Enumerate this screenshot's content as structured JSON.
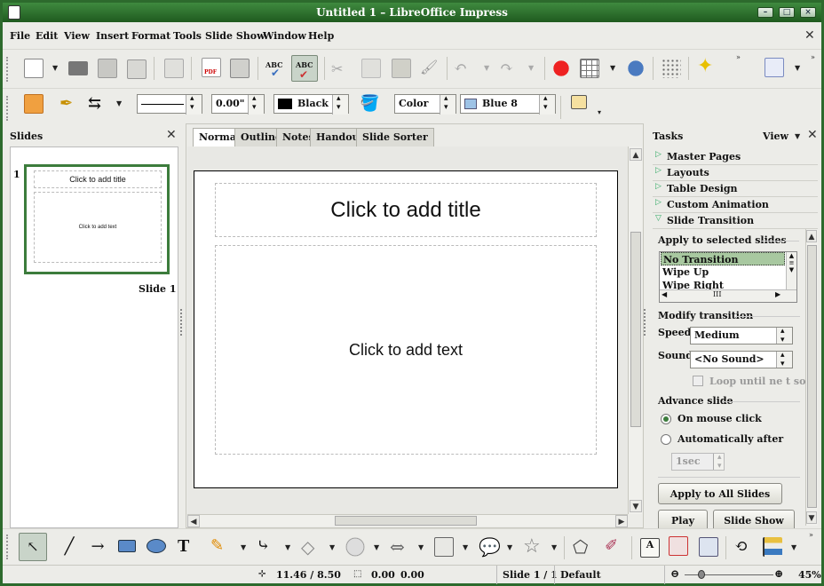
{
  "window": {
    "title": "Untitled  1  –  LibreOffice  Impress"
  },
  "menu": [
    "File",
    "Edit",
    "View",
    "Insert",
    "Format",
    "Tools",
    "Slide Show",
    "Window",
    "Help"
  ],
  "toolbar2": {
    "line_width": "0.00\"",
    "line_color": "Black",
    "area_style": "Color",
    "area_color": "Blue 8"
  },
  "slides_panel": {
    "title": "Slides",
    "slide_number": "1",
    "slide_label": "Slide  1",
    "thumb_title": "Click to add title",
    "thumb_text": "Click to add text"
  },
  "view_tabs": [
    "Normal",
    "Outline",
    "Notes",
    "Handout",
    "Slide Sorter"
  ],
  "slide": {
    "title_placeholder": "Click to add title",
    "text_placeholder": "Click to add text"
  },
  "tasks": {
    "title": "Tasks",
    "view_label": "View",
    "sections": [
      "Master Pages",
      "Layouts",
      "Table Design",
      "Custom Animation",
      "Slide Transition"
    ],
    "apply_label": "Apply  to  selected  slides",
    "transitions": [
      "No  Transition",
      "Wipe  Up",
      "Wipe  Right"
    ],
    "modify_label": "Modify  transition",
    "speed_label": "Speed",
    "speed_value": "Medium",
    "sound_label": "Sound",
    "sound_value": "<No  Sound>",
    "loop_label": "Loop  until  ne  t  sou",
    "advance_label": "Advance  slide",
    "on_click": "On  mouse  click",
    "auto_after": "Automatically  after",
    "seconds": "1sec",
    "apply_all": "Apply  to  All  Slides",
    "play": "Play",
    "slide_show": "Slide  Show"
  },
  "status": {
    "position": "11.46  /  8.50",
    "size_a": "0.00",
    "size_b": "0.00",
    "slide": "Slide  1  /  1",
    "layout": "Default",
    "zoom": "45%"
  }
}
